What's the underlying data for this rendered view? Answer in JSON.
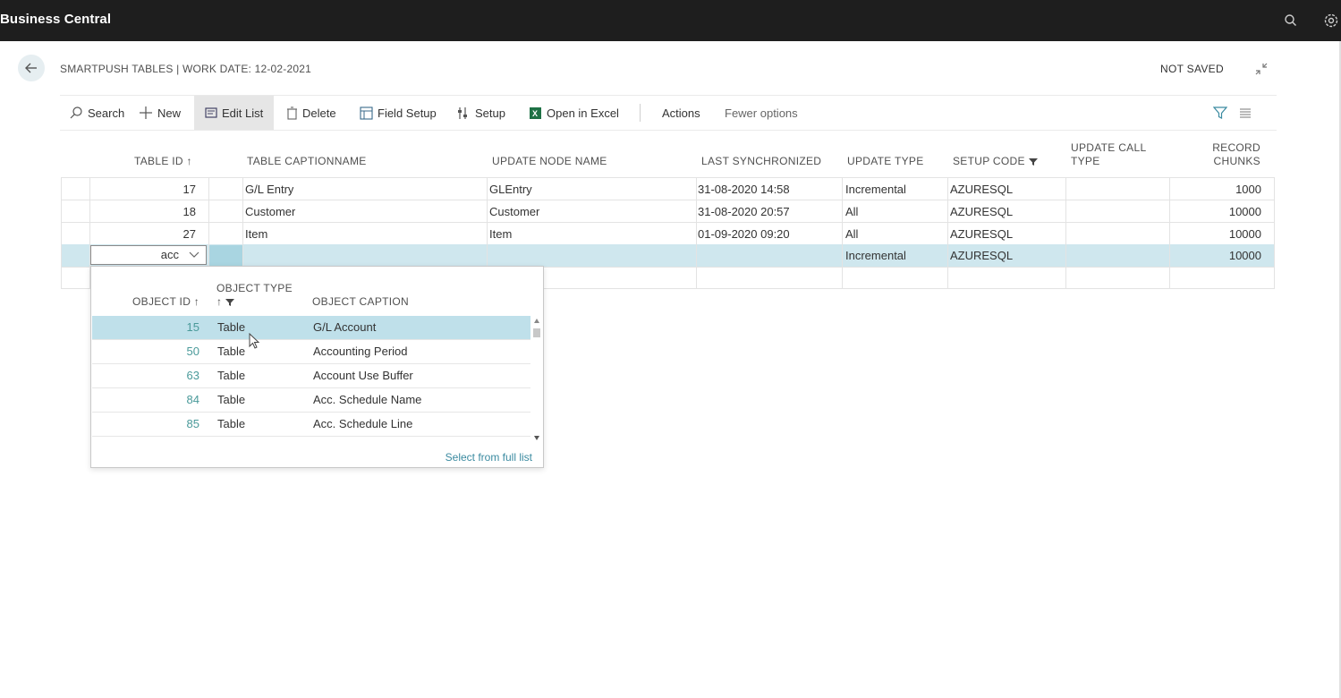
{
  "app": {
    "name": "Business Central"
  },
  "header": {
    "title": "SMARTPUSH TABLES | WORK DATE: 12-02-2021",
    "status": "NOT SAVED"
  },
  "actions": {
    "search": "Search",
    "new": "New",
    "edit_list": "Edit List",
    "delete": "Delete",
    "field_setup": "Field Setup",
    "setup": "Setup",
    "open_in_excel": "Open in Excel",
    "actions": "Actions",
    "fewer_options": "Fewer options"
  },
  "table": {
    "columns": {
      "table_id": "TABLE ID ↑",
      "table_captionname": "TABLE CAPTIONNAME",
      "update_node_name": "UPDATE NODE NAME",
      "last_synchronized": "LAST SYNCHRONIZED",
      "update_type": "UPDATE TYPE",
      "setup_code": "SETUP CODE",
      "update_call_type_1": "UPDATE CALL",
      "update_call_type_2": "TYPE",
      "record_chunks_1": "RECORD",
      "record_chunks_2": "CHUNKS"
    },
    "rows": [
      {
        "table_id": "17",
        "caption": "G/L Entry",
        "node": "GLEntry",
        "last_sync": "31-08-2020 14:58",
        "update_type": "Incremental",
        "setup_code": "AZURESQL",
        "call_type": "",
        "chunks": "1000"
      },
      {
        "table_id": "18",
        "caption": "Customer",
        "node": "Customer",
        "last_sync": "31-08-2020 20:57",
        "update_type": "All",
        "setup_code": "AZURESQL",
        "call_type": "",
        "chunks": "10000"
      },
      {
        "table_id": "27",
        "caption": "Item",
        "node": "Item",
        "last_sync": "01-09-2020 09:20",
        "update_type": "All",
        "setup_code": "AZURESQL",
        "call_type": "",
        "chunks": "10000"
      }
    ],
    "edit_row": {
      "input_value": "acc",
      "update_type": "Incremental",
      "setup_code": "AZURESQL",
      "chunks": "10000"
    }
  },
  "lookup": {
    "columns": {
      "object_id": "OBJECT ID ↑",
      "object_type": "OBJECT TYPE",
      "object_caption": "OBJECT CAPTION"
    },
    "rows": [
      {
        "id": "15",
        "type": "Table",
        "caption": "G/L Account"
      },
      {
        "id": "50",
        "type": "Table",
        "caption": "Accounting Period"
      },
      {
        "id": "63",
        "type": "Table",
        "caption": "Account Use Buffer"
      },
      {
        "id": "84",
        "type": "Table",
        "caption": "Acc. Schedule Name"
      },
      {
        "id": "85",
        "type": "Table",
        "caption": "Acc. Schedule Line"
      }
    ],
    "footer_link": "Select from full list"
  },
  "colors": {
    "topbar": "#1e1e1e",
    "selected_row": "#cfe7ee",
    "link": "#3a8aa0"
  }
}
